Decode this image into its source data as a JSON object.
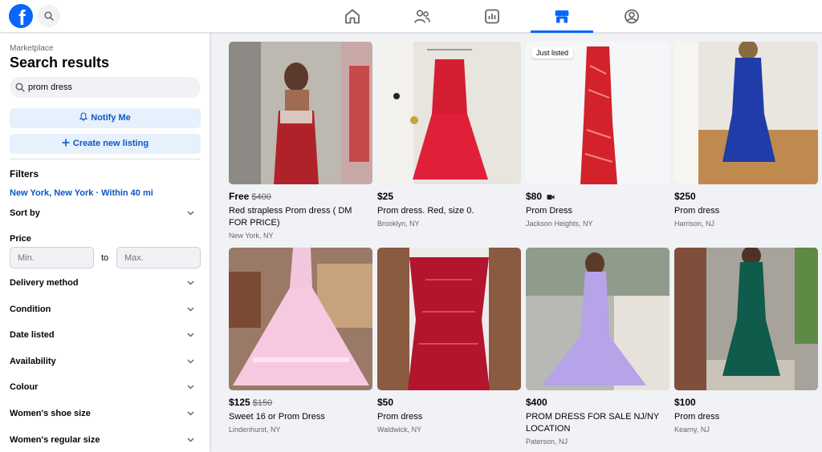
{
  "colors": {
    "brand": "#0866ff",
    "link": "#0a57c8",
    "bg": "#f0f2f5"
  },
  "top_nav": {
    "logo_icon": "facebook-logo-icon",
    "search_icon": "search-icon",
    "tabs": [
      {
        "icon": "home-icon",
        "active": false
      },
      {
        "icon": "friends-icon",
        "active": false
      },
      {
        "icon": "dashboard-icon",
        "active": false
      },
      {
        "icon": "marketplace-icon",
        "active": true
      },
      {
        "icon": "profile-circle-icon",
        "active": false
      }
    ]
  },
  "sidebar": {
    "breadcrumb": "Marketplace",
    "title": "Search results",
    "search": {
      "value": "prom dress"
    },
    "notify_label": "Notify Me",
    "create_label": "Create new listing",
    "filters_heading": "Filters",
    "location": "New York, New York · Within 40 mi",
    "sort_label": "Sort by",
    "price_heading": "Price",
    "price_min_placeholder": "Min.",
    "price_to": "to",
    "price_max_placeholder": "Max.",
    "filters": [
      "Delivery method",
      "Condition",
      "Date listed",
      "Availability",
      "Colour",
      "Women's shoe size",
      "Women's regular size"
    ]
  },
  "listings": [
    {
      "price": "Free",
      "old_price": "$400",
      "title": "Red strapless Prom dress ( DM FOR PRICE)",
      "location": "New York, NY",
      "badge": "",
      "has_video": false
    },
    {
      "price": "$25",
      "old_price": "",
      "title": "Prom dress. Red, size 0.",
      "location": "Brooklyn, NY",
      "badge": "",
      "has_video": false
    },
    {
      "price": "$80",
      "old_price": "",
      "title": "Prom Dress",
      "location": "Jackson Heights, NY",
      "badge": "Just listed",
      "has_video": true
    },
    {
      "price": "$250",
      "old_price": "",
      "title": "Prom dress",
      "location": "Harrison, NJ",
      "badge": "",
      "has_video": false
    },
    {
      "price": "$125",
      "old_price": "$150",
      "title": "Sweet 16 or Prom Dress",
      "location": "Lindenhurst, NY",
      "badge": "",
      "has_video": false
    },
    {
      "price": "$50",
      "old_price": "",
      "title": "Prom dress",
      "location": "Waldwick, NY",
      "badge": "",
      "has_video": false
    },
    {
      "price": "$400",
      "old_price": "",
      "title": "PROM DRESS FOR SALE NJ/NY LOCATION",
      "location": "Paterson, NJ",
      "badge": "",
      "has_video": false
    },
    {
      "price": "$100",
      "old_price": "",
      "title": "Prom dress",
      "location": "Kearny, NJ",
      "badge": "",
      "has_video": false
    }
  ]
}
